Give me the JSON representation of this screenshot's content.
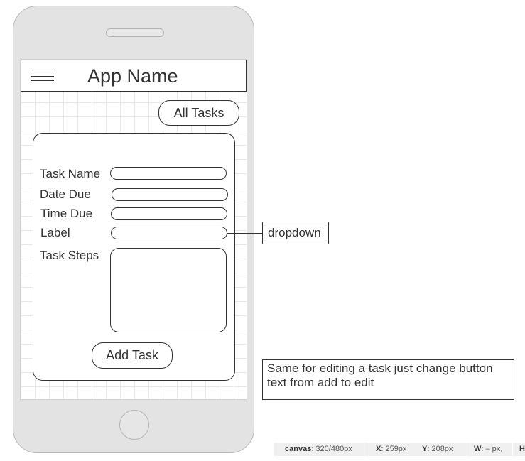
{
  "app": {
    "title": "App Name"
  },
  "header": {
    "all_tasks_label": "All Tasks"
  },
  "form": {
    "fields": [
      {
        "label": "Task Name",
        "value": ""
      },
      {
        "label": "Date Due",
        "value": ""
      },
      {
        "label": "Time Due",
        "value": ""
      },
      {
        "label": "Label",
        "value": ""
      }
    ],
    "task_steps_label": "Task Steps",
    "task_steps_value": "",
    "submit_label": "Add Task"
  },
  "annotations": {
    "dropdown": "dropdown",
    "edit_note": "Same for editing a task just change button text from add to edit"
  },
  "statusbar": {
    "canvas_key": "canvas",
    "canvas_value": ": 320/480px",
    "x_key": "X",
    "x_value": ": 259px",
    "y_key": "Y",
    "y_value": ": 208px",
    "w_key": "W",
    "w_value": ": – px,",
    "h_key": "H"
  },
  "icons": {
    "menu": "hamburger-menu-icon"
  },
  "colors": {
    "outline": "#333333",
    "device": "#e3e3e3",
    "grid": "#e8e8e8"
  }
}
